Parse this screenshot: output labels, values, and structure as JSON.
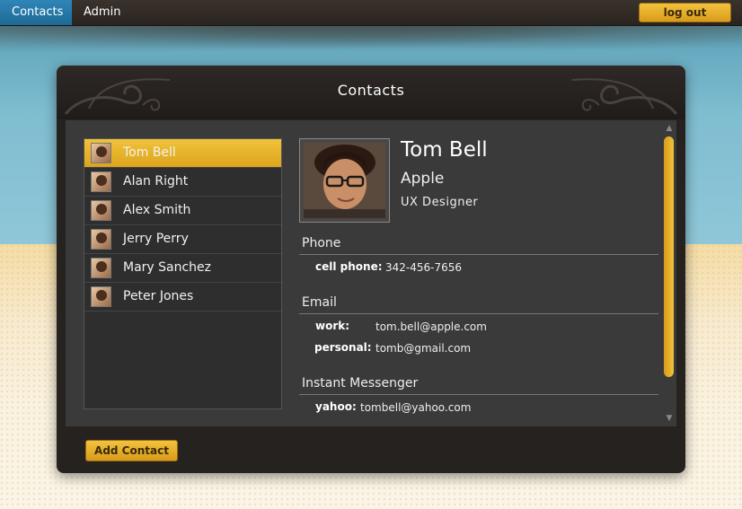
{
  "topbar": {
    "tabs": [
      {
        "label": "Contacts"
      },
      {
        "label": "Admin"
      }
    ],
    "logout_label": "log out"
  },
  "panel": {
    "title": "Contacts",
    "add_contact_label": "Add Contact"
  },
  "contacts": [
    {
      "name": "Tom Bell",
      "selected": true
    },
    {
      "name": "Alan Right"
    },
    {
      "name": "Alex Smith"
    },
    {
      "name": "Jerry Perry"
    },
    {
      "name": "Mary Sanchez"
    },
    {
      "name": "Peter Jones"
    }
  ],
  "detail": {
    "name": "Tom Bell",
    "company": "Apple",
    "title": "UX Designer",
    "phone": {
      "section": "Phone",
      "label": "cell phone:",
      "value": "342-456-7656"
    },
    "email": {
      "section": "Email",
      "items": [
        {
          "label": "work:",
          "value": "tom.bell@apple.com"
        },
        {
          "label": "personal:",
          "value": "tomb@gmail.com"
        }
      ]
    },
    "im": {
      "section": "Instant Messenger",
      "items": [
        {
          "label": "yahoo:",
          "value": "tombell@yahoo.com"
        }
      ]
    }
  },
  "colors": {
    "accent": "#e8b42c",
    "panel": "#262220",
    "content": "#3a3a3a",
    "tab_active": "#2276a6"
  }
}
